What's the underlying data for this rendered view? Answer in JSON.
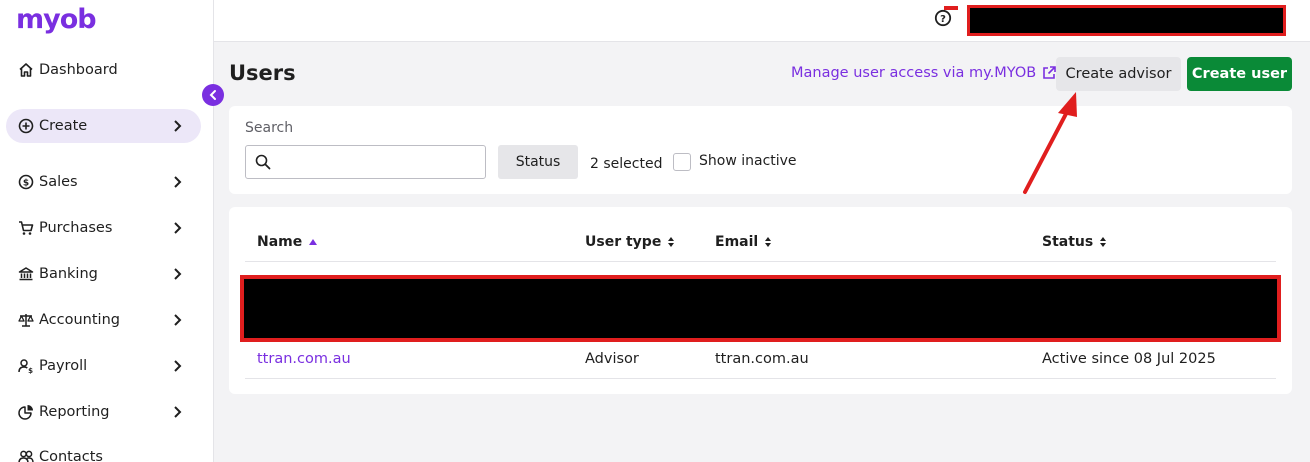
{
  "app": {
    "logo": "myob"
  },
  "sidebar": {
    "items": [
      {
        "label": "Dashboard",
        "icon": "home-icon",
        "has_chevron": false
      },
      {
        "label": "Create",
        "icon": "plus-circle-icon",
        "has_chevron": true,
        "active": true
      },
      {
        "label": "Sales",
        "icon": "dollar-circle-icon",
        "has_chevron": true
      },
      {
        "label": "Purchases",
        "icon": "cart-icon",
        "has_chevron": true
      },
      {
        "label": "Banking",
        "icon": "bank-icon",
        "has_chevron": true
      },
      {
        "label": "Accounting",
        "icon": "scales-icon",
        "has_chevron": true
      },
      {
        "label": "Payroll",
        "icon": "person-dollar-icon",
        "has_chevron": true
      },
      {
        "label": "Reporting",
        "icon": "pie-chart-icon",
        "has_chevron": true
      },
      {
        "label": "Contacts",
        "icon": "people-icon",
        "has_chevron": false
      }
    ]
  },
  "topbar": {
    "help_icon": "help-circle-icon"
  },
  "page": {
    "title": "Users",
    "manage_link": "Manage user access via my.MYOB",
    "create_advisor": "Create advisor",
    "create_user": "Create user"
  },
  "filters": {
    "search_label": "Search",
    "search_value": "",
    "status_button": "Status",
    "status_selected": "2 selected",
    "show_inactive_label": "Show inactive",
    "show_inactive_checked": false
  },
  "table": {
    "columns": [
      "Name",
      "User type",
      "Email",
      "Status"
    ],
    "rows": [
      {
        "name": "ttran.com.au",
        "user_type": "Advisor",
        "email": "ttran.com.au",
        "status": "Active since 08 Jul 2025"
      }
    ]
  },
  "colors": {
    "brand_purple": "#7a2fe0",
    "primary_green": "#0a8a37",
    "annotation_red": "#e01e1e",
    "highlight_yellow": "#f2f21a"
  }
}
